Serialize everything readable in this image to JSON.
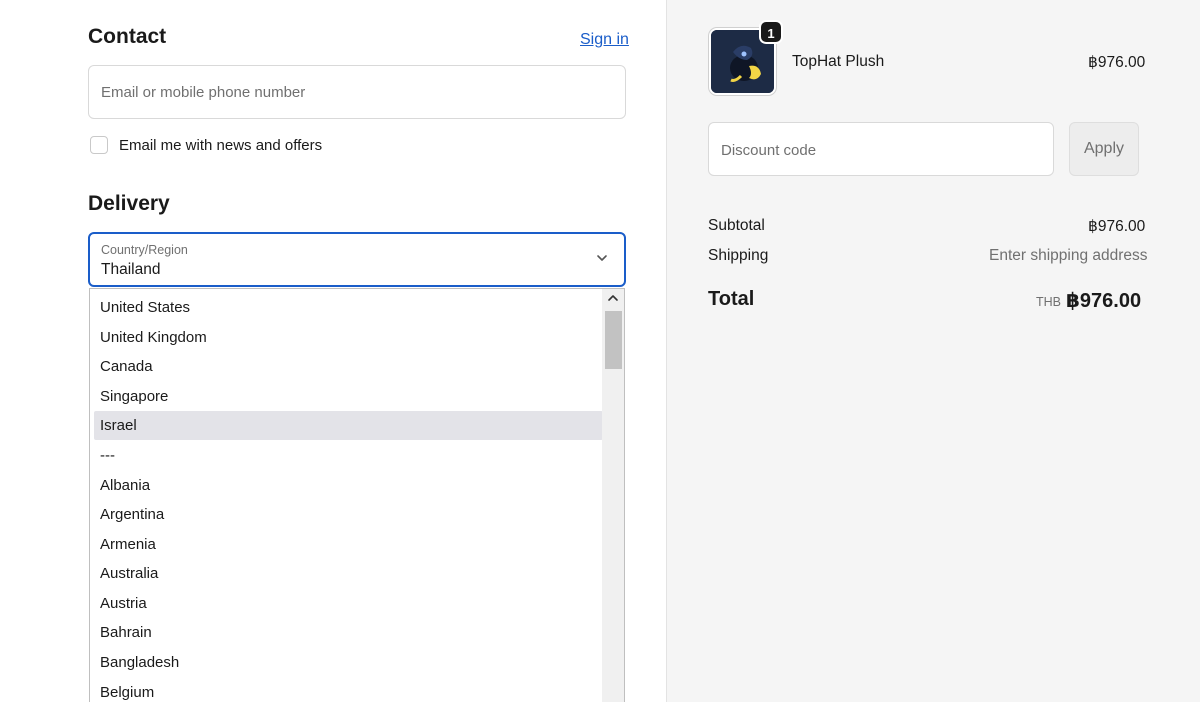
{
  "contact": {
    "heading": "Contact",
    "sign_in": "Sign in",
    "email_placeholder": "Email or mobile phone number",
    "news_label": "Email me with news and offers",
    "news_checked": false
  },
  "delivery": {
    "heading": "Delivery",
    "country_label": "Country/Region",
    "country_value": "Thailand",
    "options": [
      "United States",
      "United Kingdom",
      "Canada",
      "Singapore",
      "Israel",
      "---",
      "Albania",
      "Argentina",
      "Armenia",
      "Australia",
      "Austria",
      "Bahrain",
      "Bangladesh",
      "Belgium"
    ],
    "highlighted_option": "Israel"
  },
  "summary": {
    "product_name": "TopHat Plush",
    "product_price": "฿976.00",
    "quantity": "1",
    "discount_placeholder": "Discount code",
    "apply_label": "Apply",
    "subtotal_label": "Subtotal",
    "subtotal_value": "฿976.00",
    "shipping_label": "Shipping",
    "shipping_value": "Enter shipping address",
    "total_label": "Total",
    "total_currency": "THB",
    "total_value": "฿976.00"
  },
  "colors": {
    "accent": "#1a5dc9",
    "sidebar_bg": "#f5f5f5",
    "option_highlight": "#e3e3e8"
  }
}
